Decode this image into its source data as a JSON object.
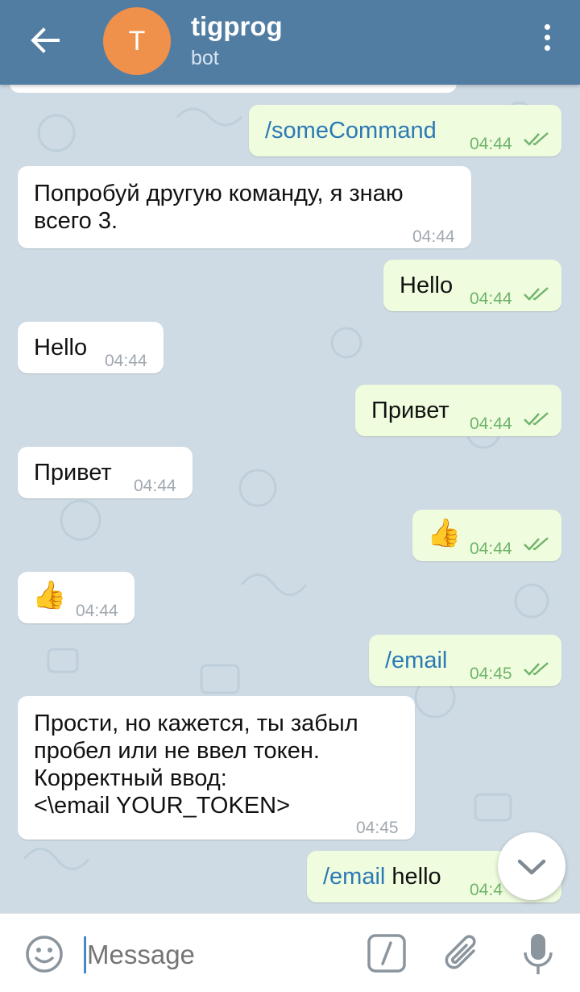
{
  "header": {
    "avatar_letter": "T",
    "title": "tigprog",
    "subtitle": "bot"
  },
  "messages": [
    {
      "dir": "out",
      "text": "/someCommand",
      "time": "04:44"
    },
    {
      "dir": "in",
      "text": "Попробуй другую команду, я знаю\nвсего 3.",
      "time": "04:44"
    },
    {
      "dir": "out",
      "text": "Hello",
      "time": "04:44"
    },
    {
      "dir": "in",
      "text": "Hello",
      "time": "04:44"
    },
    {
      "dir": "out",
      "text": "Привет",
      "time": "04:44"
    },
    {
      "dir": "in",
      "text": "Привет",
      "time": "04:44"
    },
    {
      "dir": "out",
      "text": "👍",
      "time": "04:44"
    },
    {
      "dir": "in",
      "text": "👍",
      "time": "04:44"
    },
    {
      "dir": "out",
      "text": "/email",
      "time": "04:45"
    },
    {
      "dir": "in",
      "text": "Прости, но кажется, ты забыл\nпробел или не ввел токен.\nКорректный ввод:\n<\\email YOUR_TOKEN>",
      "time": "04:45"
    },
    {
      "dir": "out",
      "command": "/email",
      "text": " hello",
      "time": "04:4"
    }
  ],
  "input": {
    "placeholder": "Message"
  },
  "colors": {
    "header": "#527da3",
    "avatar": "#f0914b",
    "outgoing_bubble": "#effdde",
    "incoming_bubble": "#ffffff",
    "command_link": "#2d79b6",
    "read_check": "#6fb36a"
  },
  "icons": {
    "back": "arrow-left-icon",
    "menu": "more-vertical-icon",
    "read": "double-check-icon",
    "scroll": "chevron-down-icon",
    "emoji": "smile-icon",
    "commands": "slash-command-icon",
    "attach": "paperclip-icon",
    "voice": "microphone-icon"
  }
}
